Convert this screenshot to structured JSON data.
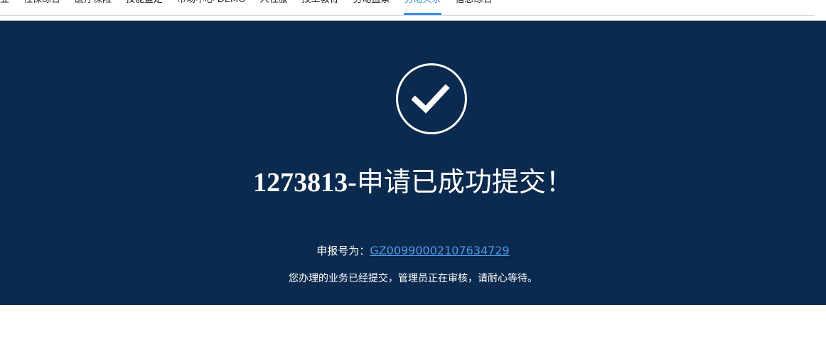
{
  "nav": {
    "items": [
      {
        "label": "业"
      },
      {
        "label": "社保综合"
      },
      {
        "label": "医疗保险"
      },
      {
        "label": "技能鉴定"
      },
      {
        "label": "市场中心-DEMO"
      },
      {
        "label": "人社服"
      },
      {
        "label": "技工教育"
      },
      {
        "label": "劳动监察"
      },
      {
        "label": "劳动关系"
      },
      {
        "label": "信息综合"
      }
    ],
    "active_index": 8
  },
  "result": {
    "code": "1273813-",
    "message": "申请已成功提交！",
    "ref_label": "申报号为：",
    "ref_number": "GZ00990002107634729",
    "note": "您办理的业务已经提交，管理员正在审核，请耐心等待。"
  },
  "colors": {
    "banner_bg": "#0a2a4f",
    "accent": "#3a8ee6",
    "link": "#4d9be8"
  },
  "icons": {
    "success": "check-circle-icon"
  }
}
